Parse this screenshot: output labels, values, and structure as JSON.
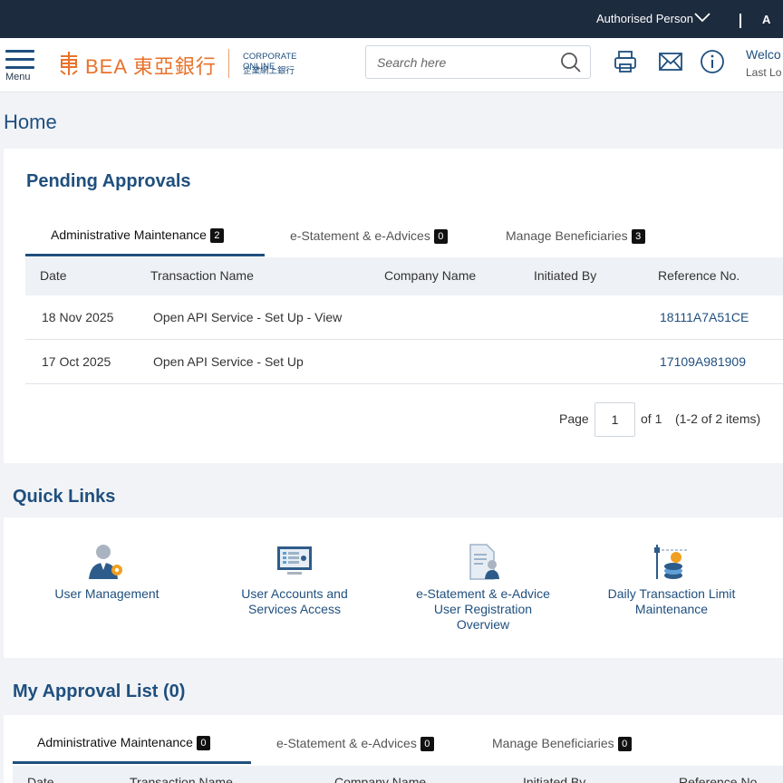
{
  "topbar": {
    "authorised_person": "Authorised Person",
    "language": "A"
  },
  "header": {
    "menu_label": "Menu",
    "logo_text": "BEA 東亞銀行",
    "corporate_online_en": "CORPORATE ONLINE",
    "corporate_online_zh": "企業網上銀行",
    "search_placeholder": "Search here",
    "welcome": "Welco",
    "last_login": "Last Lo"
  },
  "page_title": "Home",
  "pending": {
    "title": "Pending Approvals",
    "tabs": [
      {
        "label": "Administrative Maintenance",
        "count": "2"
      },
      {
        "label": "e-Statement & e-Advices",
        "count": "0"
      },
      {
        "label": "Manage Beneficiaries",
        "count": "3"
      }
    ],
    "columns": [
      "Date",
      "Transaction Name",
      "Company Name",
      "Initiated By",
      "Reference No."
    ],
    "rows": [
      {
        "date": "18 Nov 2025",
        "name": "Open API Service - Set Up - View",
        "company": "",
        "initiated": "",
        "ref": "18111A7A51CE"
      },
      {
        "date": "17 Oct 2025",
        "name": "Open API Service - Set Up",
        "company": "",
        "initiated": "",
        "ref": "17109A981909"
      }
    ],
    "pager": {
      "page_label": "Page",
      "page_value": "1",
      "of_label": "of 1",
      "items": "(1-2 of 2 items)"
    }
  },
  "quick_links": {
    "title": "Quick Links",
    "items": [
      {
        "line1": "User Management",
        "line2": "",
        "line3": "",
        "icon": "user-gear-icon"
      },
      {
        "line1": "User Accounts and",
        "line2": "Services Access",
        "line3": "",
        "icon": "monitor-list-icon"
      },
      {
        "line1": "e-Statement & e-Advice",
        "line2": "User Registration",
        "line3": "Overview",
        "icon": "document-user-icon"
      },
      {
        "line1": "Daily Transaction Limit",
        "line2": "Maintenance",
        "line3": "",
        "icon": "coins-limit-icon"
      }
    ]
  },
  "approval_list": {
    "title": "My Approval List (0)",
    "tabs": [
      {
        "label": "Administrative Maintenance",
        "count": "0"
      },
      {
        "label": "e-Statement & e-Advices",
        "count": "0"
      },
      {
        "label": "Manage Beneficiaries",
        "count": "0"
      }
    ],
    "columns": [
      "Date",
      "Transaction Name",
      "Company Name",
      "Initiated By",
      "Reference No."
    ]
  },
  "colors": {
    "navy": "#1d2b3e",
    "brand_blue": "#1f4f7e",
    "bea_orange": "#e8722b",
    "badge": "#111111"
  }
}
